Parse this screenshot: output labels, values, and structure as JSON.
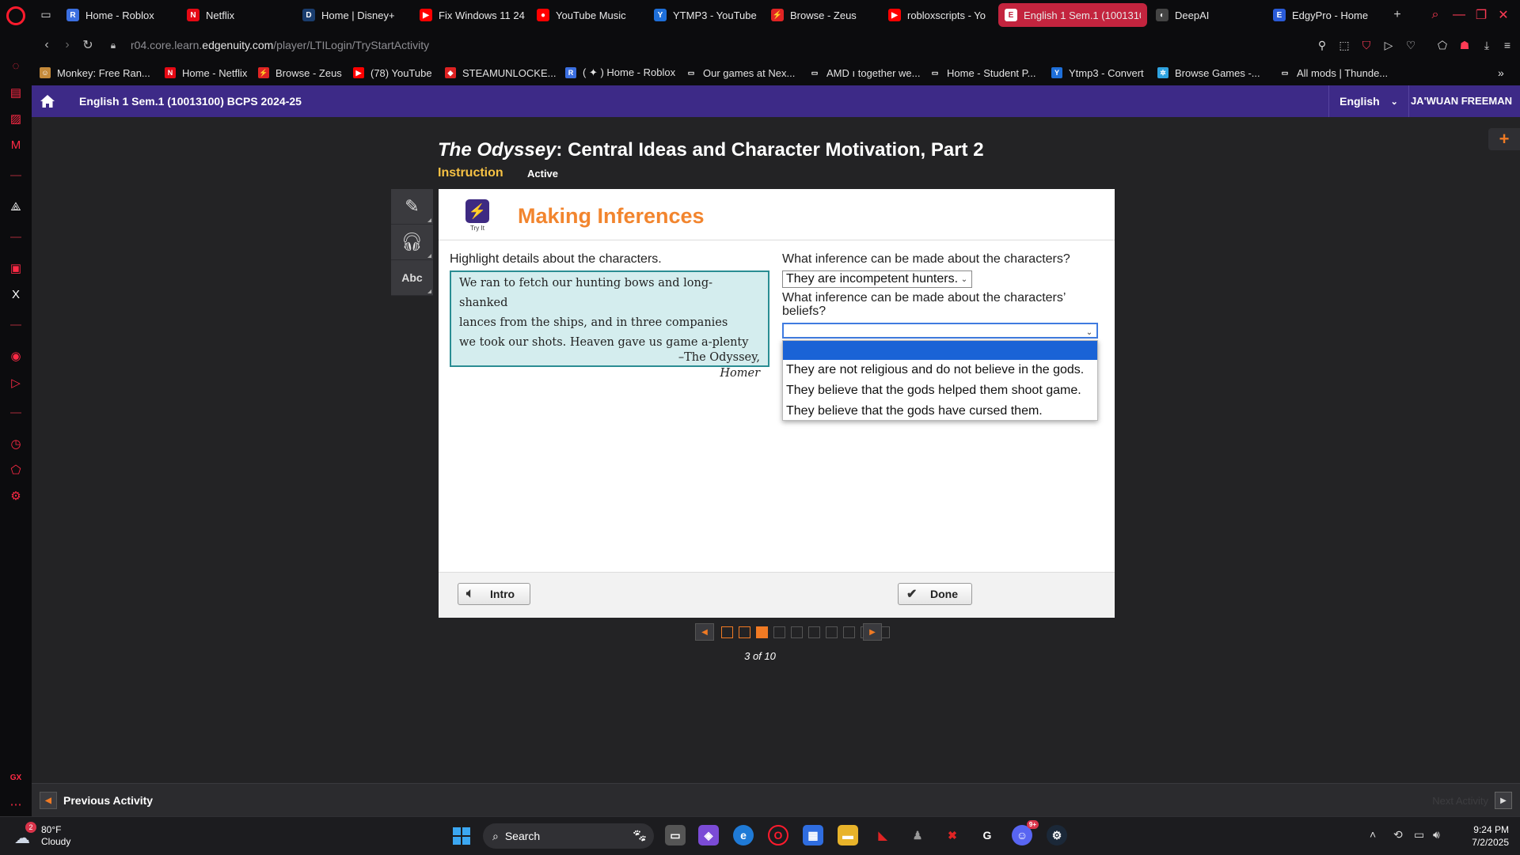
{
  "browser": {
    "tabs": [
      {
        "label": "Home - Roblox",
        "color": "#3b6fe0",
        "glyph": "R"
      },
      {
        "label": "Netflix",
        "color": "#e50914",
        "glyph": "N"
      },
      {
        "label": "Home | Disney+",
        "color": "#1a3d6e",
        "glyph": "D"
      },
      {
        "label": "Fix Windows 11 24",
        "color": "#ff0000",
        "glyph": "▶"
      },
      {
        "label": "YouTube Music",
        "color": "#ff0000",
        "glyph": "●"
      },
      {
        "label": "YTMP3 - YouTube",
        "color": "#1e6fd9",
        "glyph": "Y"
      },
      {
        "label": "Browse - Zeus",
        "color": "#e02424",
        "glyph": "⚡"
      },
      {
        "label": "robloxscripts - Yo",
        "color": "#ff0000",
        "glyph": "▶"
      },
      {
        "label": "English 1 Sem.1 (1001310",
        "color": "#ffffff",
        "glyph": "E"
      },
      {
        "label": "DeepAI",
        "color": "#444444",
        "glyph": "◐"
      },
      {
        "label": "EdgyPro - Home",
        "color": "#2a5bd7",
        "glyph": "E"
      }
    ],
    "active_tab_index": 8,
    "url_prefix": "r04.core.learn.",
    "url_domain": "edgenuity.com",
    "url_path": "/player/LTILogin/TryStartActivity",
    "bookmarks": [
      {
        "label": "Monkey: Free Ran...",
        "color": "#c58a3a",
        "glyph": "☺"
      },
      {
        "label": "Home - Netflix",
        "color": "#e50914",
        "glyph": "N"
      },
      {
        "label": "Browse - Zeus",
        "color": "#e02424",
        "glyph": "⚡"
      },
      {
        "label": "(78) YouTube",
        "color": "#ff0000",
        "glyph": "▶"
      },
      {
        "label": "STEAMUNLOCKE...",
        "color": "#d22",
        "glyph": "◆"
      },
      {
        "label": "( ✦ ) Home - Roblox",
        "color": "#3b6fe0",
        "glyph": "R"
      },
      {
        "label": "Our games at Nex...",
        "color": "#ffffff",
        "glyph": "▭"
      },
      {
        "label": "AMD ı together we...",
        "color": "#ffffff",
        "glyph": "▭"
      },
      {
        "label": "Home - Student P...",
        "color": "#ffffff",
        "glyph": "▭"
      },
      {
        "label": "Ytmp3 - Convert",
        "color": "#1e6fd9",
        "glyph": "Y"
      },
      {
        "label": "Browse Games -...",
        "color": "#2fa3e0",
        "glyph": "✲"
      },
      {
        "label": "All mods | Thunde...",
        "color": "#ffffff",
        "glyph": "▭"
      }
    ]
  },
  "header": {
    "course_title": "English 1 Sem.1 (10013100) BCPS 2024-25",
    "language": "English",
    "user_name": "JA'WUAN FREEMAN"
  },
  "activity": {
    "title_italic": "The Odyssey",
    "title_rest": ": Central Ideas and Character Motivation, Part 2",
    "stage": "Instruction",
    "status": "Active"
  },
  "frame": {
    "tryit_label": "Try It",
    "heading": "Making Inferences",
    "highlight_prompt": "Highlight details about the characters.",
    "passage_lines": [
      "We ran to fetch our hunting bows and long-shanked",
      "lances from the ships, and in three companies",
      "we took our shots. Heaven gave us game a-plenty"
    ],
    "citation_line1": "–The Odyssey,",
    "citation_line2": "Homer",
    "question1": "What inference can be made about the characters?",
    "question1_answer": "They are incompetent hunters.",
    "question2": "What inference can be made about the characters’ beliefs?",
    "question2_answer": "",
    "question2_options": [
      "They are not religious and do not believe in the gods.",
      "They believe that the gods helped them shoot game.",
      "They believe that the gods have cursed them."
    ],
    "intro_label": "Intro",
    "done_label": "Done"
  },
  "pager": {
    "current": 3,
    "total": 10,
    "label": "3 of 10"
  },
  "bottom_nav": {
    "previous_label": "Previous Activity",
    "next_label": "Next Activity"
  },
  "taskbar": {
    "weather_temp": "80°F",
    "weather_desc": "Cloudy",
    "weather_badge": "2",
    "search_placeholder": "Search",
    "discord_badge": "9+",
    "time": "9:24 PM",
    "date": "7/2/2025"
  },
  "colors": {
    "header_purple": "#3d2a87",
    "accent_orange": "#f2852e",
    "active_tab": "#c3243e",
    "opera_red": "#ff1b2d"
  }
}
